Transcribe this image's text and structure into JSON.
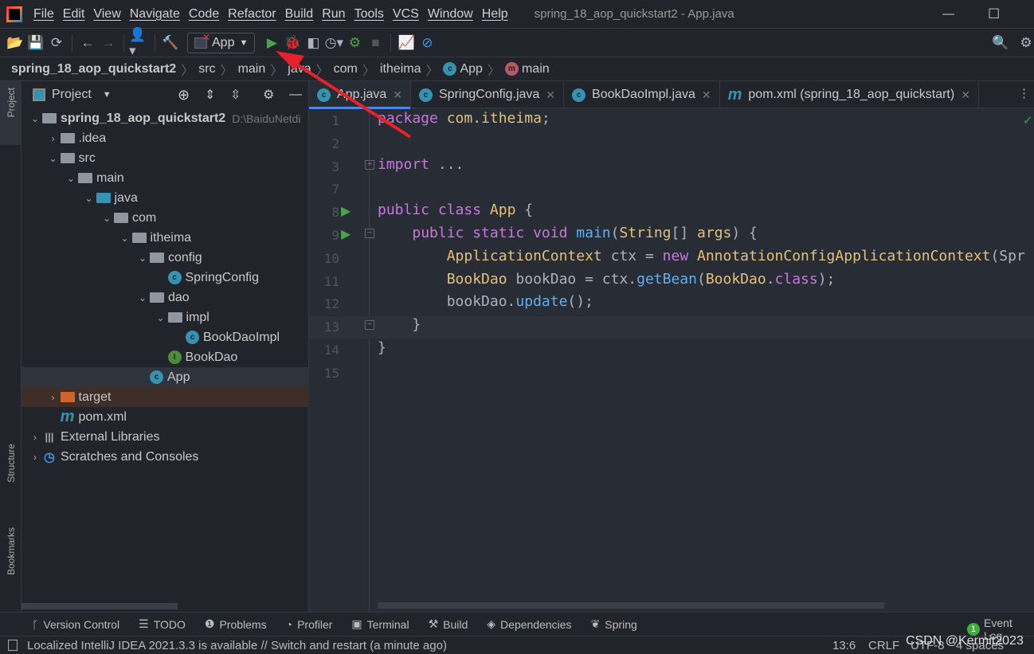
{
  "window": {
    "title": "spring_18_aop_quickstart2 - App.java",
    "logo": "intellij-logo",
    "minimize": "—",
    "maximize": "☐"
  },
  "menu": [
    "File",
    "Edit",
    "View",
    "Navigate",
    "Code",
    "Refactor",
    "Build",
    "Run",
    "Tools",
    "VCS",
    "Window",
    "Help"
  ],
  "toolbar": {
    "run_config": "App"
  },
  "breadcrumb": [
    "spring_18_aop_quickstart2",
    "src",
    "main",
    "java",
    "com",
    "itheima",
    "App",
    "main"
  ],
  "project": {
    "title": "Project",
    "tree": [
      {
        "label": "spring_18_aop_quickstart2",
        "path": "D:\\BaiduNetdi",
        "depth": 0,
        "arrow": "open",
        "icon": "module"
      },
      {
        "label": ".idea",
        "depth": 1,
        "arrow": "closed",
        "icon": "folder"
      },
      {
        "label": "src",
        "depth": 1,
        "arrow": "open",
        "icon": "folder"
      },
      {
        "label": "main",
        "depth": 2,
        "arrow": "open",
        "icon": "folder"
      },
      {
        "label": "java",
        "depth": 3,
        "arrow": "open",
        "icon": "source-folder"
      },
      {
        "label": "com",
        "depth": 4,
        "arrow": "open",
        "icon": "package"
      },
      {
        "label": "itheima",
        "depth": 5,
        "arrow": "open",
        "icon": "package"
      },
      {
        "label": "config",
        "depth": 6,
        "arrow": "open",
        "icon": "package"
      },
      {
        "label": "SpringConfig",
        "depth": 7,
        "arrow": "",
        "icon": "class"
      },
      {
        "label": "dao",
        "depth": 6,
        "arrow": "open",
        "icon": "package"
      },
      {
        "label": "impl",
        "depth": 7,
        "arrow": "open",
        "icon": "package"
      },
      {
        "label": "BookDaoImpl",
        "depth": 8,
        "arrow": "",
        "icon": "class"
      },
      {
        "label": "BookDao",
        "depth": 7,
        "arrow": "",
        "icon": "interface"
      },
      {
        "label": "App",
        "depth": 6,
        "arrow": "",
        "icon": "class-runnable",
        "selected": true
      },
      {
        "label": "target",
        "depth": 1,
        "arrow": "closed",
        "icon": "excluded-folder",
        "highlight": true
      },
      {
        "label": "pom.xml",
        "depth": 1,
        "arrow": "",
        "icon": "maven"
      },
      {
        "label": "External Libraries",
        "depth": 0,
        "arrow": "closed",
        "icon": "libraries"
      },
      {
        "label": "Scratches and Consoles",
        "depth": 0,
        "arrow": "closed",
        "icon": "scratches"
      }
    ]
  },
  "side_tabs": {
    "project": "Project",
    "structure": "Structure",
    "bookmarks": "Bookmarks"
  },
  "tabs": [
    {
      "label": "App.java",
      "icon": "class",
      "active": true
    },
    {
      "label": "SpringConfig.java",
      "icon": "class"
    },
    {
      "label": "BookDaoImpl.java",
      "icon": "class"
    },
    {
      "label": "pom.xml (spring_18_aop_quickstart)",
      "icon": "maven"
    }
  ],
  "code": [
    {
      "n": "1",
      "t": [
        [
          "kw",
          "package "
        ],
        [
          "ty",
          "com.itheima"
        ],
        [
          "id",
          ";"
        ]
      ]
    },
    {
      "n": "2",
      "t": []
    },
    {
      "n": "3",
      "t": [
        [
          "kw",
          "import "
        ],
        [
          "id",
          "..."
        ]
      ],
      "fold": "plus"
    },
    {
      "n": "7",
      "t": []
    },
    {
      "n": "8",
      "t": [
        [
          "kw",
          "public class "
        ],
        [
          "ty",
          "App "
        ],
        [
          "id",
          "{"
        ]
      ],
      "run": true
    },
    {
      "n": "9",
      "t": [
        [
          "id",
          "    "
        ],
        [
          "kw",
          "public static void "
        ],
        [
          "fn",
          "main"
        ],
        [
          "id",
          "("
        ],
        [
          "ty",
          "String"
        ],
        [
          "id",
          "[] "
        ],
        [
          "ty",
          "args"
        ],
        [
          "id",
          ") {"
        ]
      ],
      "run": true,
      "fold": "minus"
    },
    {
      "n": "10",
      "t": [
        [
          "id",
          "        "
        ],
        [
          "ty",
          "ApplicationContext "
        ],
        [
          "id",
          "ctx = "
        ],
        [
          "kw",
          "new "
        ],
        [
          "ty",
          "AnnotationConfigApplicationContext"
        ],
        [
          "id",
          "(Spr"
        ]
      ]
    },
    {
      "n": "11",
      "t": [
        [
          "id",
          "        "
        ],
        [
          "ty",
          "BookDao "
        ],
        [
          "id",
          "bookDao = ctx."
        ],
        [
          "fn",
          "getBean"
        ],
        [
          "id",
          "("
        ],
        [
          "ty",
          "BookDao"
        ],
        [
          "id",
          "."
        ],
        [
          "kw",
          "class"
        ],
        [
          "id",
          ");"
        ]
      ]
    },
    {
      "n": "12",
      "t": [
        [
          "id",
          "        bookDao."
        ],
        [
          "fn",
          "update"
        ],
        [
          "id",
          "();"
        ]
      ]
    },
    {
      "n": "13",
      "t": [
        [
          "id",
          "    }"
        ]
      ],
      "current": true,
      "fold": "end"
    },
    {
      "n": "14",
      "t": [
        [
          "id",
          "}"
        ]
      ]
    },
    {
      "n": "15",
      "t": []
    }
  ],
  "bottom_tools": [
    {
      "label": "Version Control",
      "icon": "branch-icon"
    },
    {
      "label": "TODO",
      "icon": "list-icon"
    },
    {
      "label": "Problems",
      "icon": "warning-icon"
    },
    {
      "label": "Profiler",
      "icon": "profiler-icon"
    },
    {
      "label": "Terminal",
      "icon": "terminal-icon"
    },
    {
      "label": "Build",
      "icon": "hammer-icon"
    },
    {
      "label": "Dependencies",
      "icon": "layers-icon"
    },
    {
      "label": "Spring",
      "icon": "leaf-icon"
    }
  ],
  "event_log": {
    "count": "1",
    "label": "Event Log"
  },
  "status": {
    "message": "Localized IntelliJ IDEA 2021.3.3 is available // Switch and restart (a minute ago)",
    "position": "13:6",
    "line_sep": "CRLF",
    "encoding": "UTF-8",
    "indent": "4 spaces"
  },
  "watermark": "CSDN @Kermit2023",
  "colors": {
    "keyword": "#c678dd",
    "type": "#e5c07b",
    "method": "#61afef",
    "arrow": "#e8202a"
  }
}
